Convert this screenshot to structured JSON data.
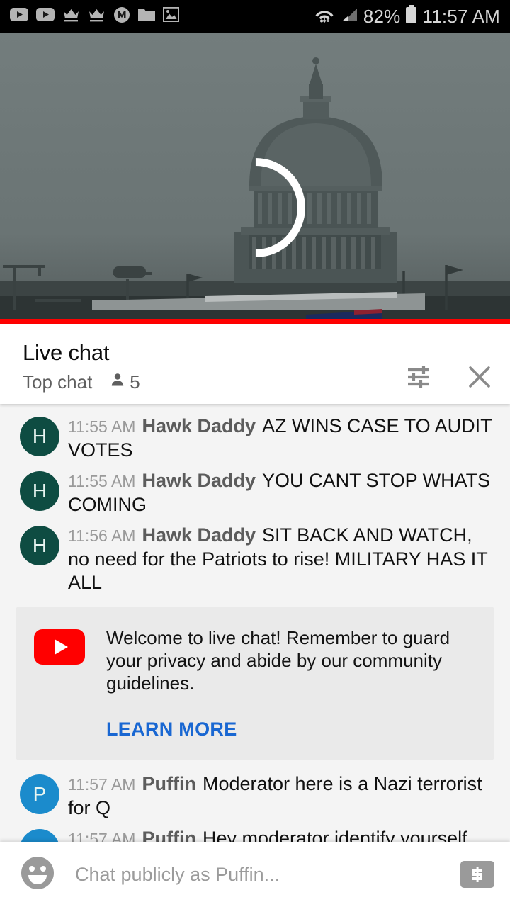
{
  "statusbar": {
    "icons": [
      "youtube-icon",
      "youtube-icon",
      "crown-icon",
      "crown-icon",
      "messenger-m-icon",
      "folder-icon",
      "gallery-image-icon"
    ],
    "wifi_icon": "wifi-icon",
    "signal_icon": "cell-signal-icon",
    "battery_percent": "82%",
    "battery_icon": "battery-icon",
    "time": "11:57 AM"
  },
  "video": {
    "alt": "US Capitol building live stream",
    "loading_spinner": "loading-spinner",
    "progress_color": "#ff0000",
    "progress_percent": 100
  },
  "chat_header": {
    "title": "Live chat",
    "mode": "Top chat",
    "viewer_count": "5",
    "viewer_icon": "person-icon",
    "settings_icon": "tune-sliders-icon",
    "close_icon": "close-x-icon"
  },
  "messages": [
    {
      "avatar_letter": "H",
      "avatar_color": "#0e4c42",
      "timestamp": "11:55 AM",
      "author": "Hawk Daddy",
      "text": "AZ WINS CASE TO AUDIT VOTES"
    },
    {
      "avatar_letter": "H",
      "avatar_color": "#0e4c42",
      "timestamp": "11:55 AM",
      "author": "Hawk Daddy",
      "text": "YOU CANT STOP WHATS COMING"
    },
    {
      "avatar_letter": "H",
      "avatar_color": "#0e4c42",
      "timestamp": "11:56 AM",
      "author": "Hawk Daddy",
      "text": "SIT BACK AND WATCH, no need for the Patriots to rise! MILITARY HAS IT ALL"
    }
  ],
  "banner": {
    "logo_icon": "youtube-logo-icon",
    "text": "Welcome to live chat! Remember to guard your privacy and abide by our community guidelines.",
    "link_label": "LEARN MORE",
    "link_color": "#1967d2"
  },
  "messages_after": [
    {
      "avatar_letter": "P",
      "avatar_color": "#1b8bcc",
      "timestamp": "11:57 AM",
      "author": "Puffin",
      "text": "Moderator here is a Nazi terrorist for Q"
    },
    {
      "avatar_letter": "P",
      "avatar_color": "#1b8bcc",
      "timestamp": "11:57 AM",
      "author": "Puffin",
      "text": "Hey moderator identify yourself you goddamn nazi"
    }
  ],
  "composer": {
    "emoji_icon": "emoji-smiley-icon",
    "placeholder": "Chat publicly as Puffin...",
    "value": "",
    "superchat_icon": "dollar-superchat-icon"
  }
}
